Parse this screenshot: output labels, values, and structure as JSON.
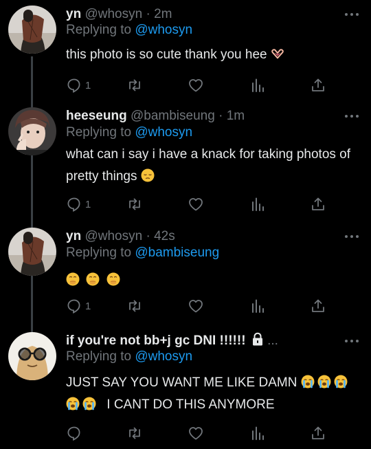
{
  "tweets": [
    {
      "name": "yn",
      "handle": "@whosyn",
      "dot": "·",
      "time": "2m",
      "replying_prefix": "Replying to",
      "replying_to": "@whosyn",
      "text": "this photo is so cute thank you hee",
      "text_emoji": [
        "heart-hands"
      ],
      "reply_count": "1"
    },
    {
      "name": "heeseung",
      "handle": "@bambiseung",
      "dot": "·",
      "time": "1m",
      "replying_prefix": "Replying to",
      "replying_to": "@whosyn",
      "text": "what can i say i have a knack for taking photos of pretty things",
      "text_emoji": [
        "pensive-face"
      ],
      "reply_count": "1"
    },
    {
      "name": "yn",
      "handle": "@whosyn",
      "dot": "·",
      "time": "42s",
      "replying_prefix": "Replying to",
      "replying_to": "@bambiseung",
      "text": "",
      "text_emoji": [
        "hand-over-mouth",
        "hand-over-mouth",
        "hand-over-mouth"
      ],
      "reply_count": "1"
    },
    {
      "name": "if you're not bb+j gc DNI !!!!!!",
      "handle": "",
      "dot": "",
      "time": "",
      "ellipsis": "...",
      "replying_prefix": "Replying to",
      "replying_to": "@whosyn",
      "text_line1": "JUST SAY YOU WANT ME LIKE DAMN",
      "text_line2": "I CANT DO THIS ANYMORE",
      "text_emoji": [
        "loudly-crying-face"
      ],
      "reply_count": ""
    }
  ],
  "icons": {
    "reply": "reply-icon",
    "retweet": "retweet-icon",
    "like": "like-icon",
    "views": "views-icon",
    "share": "share-icon",
    "more": "more-icon",
    "lock": "lock-icon"
  },
  "colors": {
    "background": "#000000",
    "text": "#e7e9ea",
    "muted": "#71767b",
    "mention": "#1d9bf0",
    "thread": "#3a3f44"
  }
}
